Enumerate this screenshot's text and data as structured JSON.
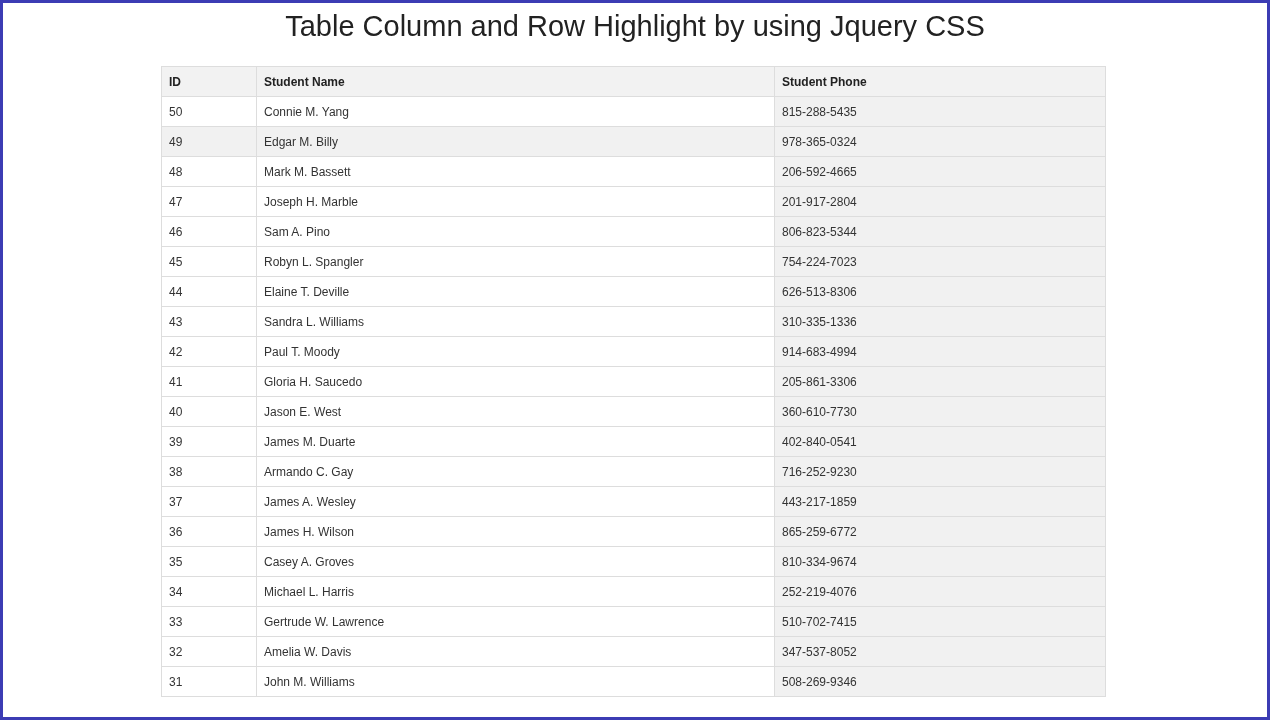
{
  "title": "Table Column and Row Highlight by using Jquery CSS",
  "table": {
    "columns": [
      {
        "label": "ID",
        "highlighted": false
      },
      {
        "label": "Student Name",
        "highlighted": false
      },
      {
        "label": "Student Phone",
        "highlighted": true
      }
    ],
    "rows": [
      {
        "cells": [
          "50",
          "Connie M. Yang",
          "815-288-5435"
        ],
        "highlighted": false
      },
      {
        "cells": [
          "49",
          "Edgar M. Billy",
          "978-365-0324"
        ],
        "highlighted": true
      },
      {
        "cells": [
          "48",
          "Mark M. Bassett",
          "206-592-4665"
        ],
        "highlighted": false
      },
      {
        "cells": [
          "47",
          "Joseph H. Marble",
          "201-917-2804"
        ],
        "highlighted": false
      },
      {
        "cells": [
          "46",
          "Sam A. Pino",
          "806-823-5344"
        ],
        "highlighted": false
      },
      {
        "cells": [
          "45",
          "Robyn L. Spangler",
          "754-224-7023"
        ],
        "highlighted": false
      },
      {
        "cells": [
          "44",
          "Elaine T. Deville",
          "626-513-8306"
        ],
        "highlighted": false
      },
      {
        "cells": [
          "43",
          "Sandra L. Williams",
          "310-335-1336"
        ],
        "highlighted": false
      },
      {
        "cells": [
          "42",
          "Paul T. Moody",
          "914-683-4994"
        ],
        "highlighted": false
      },
      {
        "cells": [
          "41",
          "Gloria H. Saucedo",
          "205-861-3306"
        ],
        "highlighted": false
      },
      {
        "cells": [
          "40",
          "Jason E. West",
          "360-610-7730"
        ],
        "highlighted": false
      },
      {
        "cells": [
          "39",
          "James M. Duarte",
          "402-840-0541"
        ],
        "highlighted": false
      },
      {
        "cells": [
          "38",
          "Armando C. Gay",
          "716-252-9230"
        ],
        "highlighted": false
      },
      {
        "cells": [
          "37",
          "James A. Wesley",
          "443-217-1859"
        ],
        "highlighted": false
      },
      {
        "cells": [
          "36",
          "James H. Wilson",
          "865-259-6772"
        ],
        "highlighted": false
      },
      {
        "cells": [
          "35",
          "Casey A. Groves",
          "810-334-9674"
        ],
        "highlighted": false
      },
      {
        "cells": [
          "34",
          "Michael L. Harris",
          "252-219-4076"
        ],
        "highlighted": false
      },
      {
        "cells": [
          "33",
          "Gertrude W. Lawrence",
          "510-702-7415"
        ],
        "highlighted": false
      },
      {
        "cells": [
          "32",
          "Amelia W. Davis",
          "347-537-8052"
        ],
        "highlighted": false
      },
      {
        "cells": [
          "31",
          "John M. Williams",
          "508-269-9346"
        ],
        "highlighted": false
      }
    ]
  }
}
